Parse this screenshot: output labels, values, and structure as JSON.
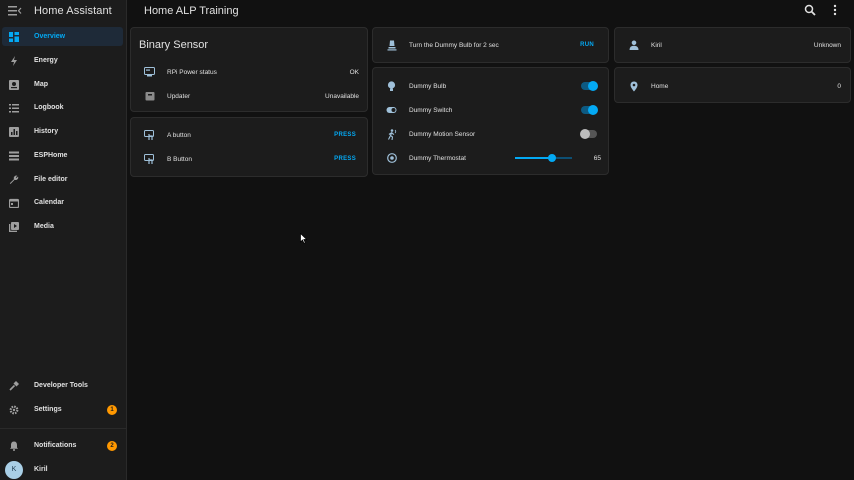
{
  "sidebar": {
    "title": "Home Assistant",
    "items": [
      {
        "label": "Overview",
        "icon": "dashboard-icon",
        "active": true
      },
      {
        "label": "Energy",
        "icon": "lightning-icon"
      },
      {
        "label": "Map",
        "icon": "map-icon"
      },
      {
        "label": "Logbook",
        "icon": "list-icon"
      },
      {
        "label": "History",
        "icon": "chart-icon"
      },
      {
        "label": "ESPHome",
        "icon": "esphome-icon"
      },
      {
        "label": "File editor",
        "icon": "wrench-icon"
      },
      {
        "label": "Calendar",
        "icon": "calendar-icon"
      },
      {
        "label": "Media",
        "icon": "media-icon"
      }
    ],
    "developer_tools": {
      "label": "Developer Tools",
      "icon": "hammer-icon"
    },
    "settings": {
      "label": "Settings",
      "icon": "gear-icon",
      "badge": "1"
    },
    "notifications": {
      "label": "Notifications",
      "icon": "bell-icon",
      "badge": "2"
    },
    "user": {
      "label": "Kiril",
      "initial": "K"
    }
  },
  "topbar": {
    "title": "Home ALP Training"
  },
  "binary_sensor_card": {
    "title": "Binary Sensor",
    "rows": [
      {
        "label": "RPi Power status",
        "value": "OK",
        "icon": "power-status-icon"
      },
      {
        "label": "Updater",
        "value": "Unavailable",
        "icon": "package-icon"
      }
    ]
  },
  "button_card": {
    "rows": [
      {
        "label": "A button",
        "action": "PRESS",
        "icon": "gesture-tap-icon"
      },
      {
        "label": "B Button",
        "action": "PRESS",
        "icon": "gesture-tap-icon"
      }
    ]
  },
  "script_card": {
    "label": "Turn the Dummy Bulb for 2 sec",
    "action": "RUN",
    "icon": "script-icon"
  },
  "dummy_card": {
    "rows": [
      {
        "label": "Dummy Bulb",
        "icon": "lightbulb-icon",
        "state": "on"
      },
      {
        "label": "Dummy Switch",
        "icon": "switch-icon",
        "state": "on"
      },
      {
        "label": "Dummy Motion Sensor",
        "icon": "motion-sensor-icon",
        "state": "off"
      },
      {
        "label": "Dummy Thermostat",
        "icon": "thermostat-icon",
        "value": "65",
        "level": 0.65
      }
    ]
  },
  "person_card": {
    "label": "Kiril",
    "value": "Unknown",
    "icon": "person-icon"
  },
  "zone_card": {
    "label": "Home",
    "value": "0",
    "icon": "map-marker-icon"
  },
  "colors": {
    "accent": "#03a9f4",
    "badge": "#ff9800",
    "background": "#111111",
    "card": "#1c1c1c"
  }
}
